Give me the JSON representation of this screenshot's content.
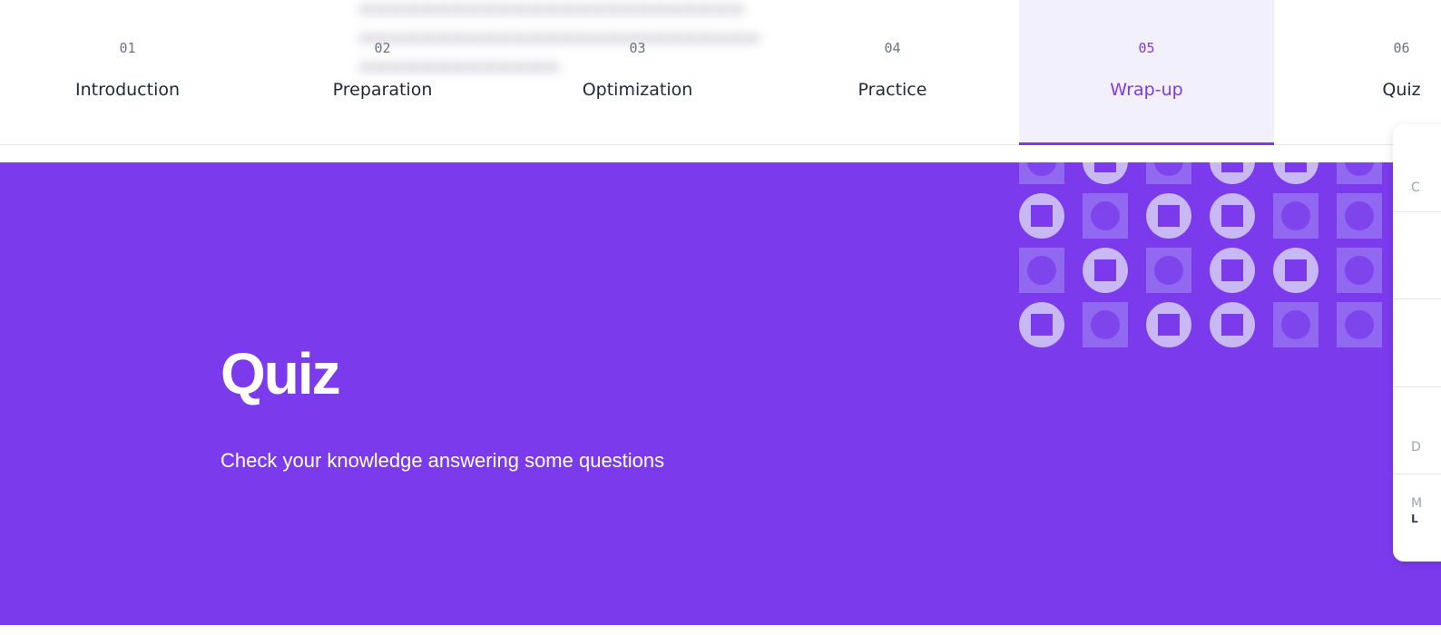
{
  "steps": [
    {
      "number": "01",
      "label": "Introduction",
      "active": false
    },
    {
      "number": "02",
      "label": "Preparation",
      "active": false
    },
    {
      "number": "03",
      "label": "Optimization",
      "active": false
    },
    {
      "number": "04",
      "label": "Practice",
      "active": false
    },
    {
      "number": "05",
      "label": "Wrap-up",
      "active": true
    },
    {
      "number": "06",
      "label": "Quiz",
      "active": false
    }
  ],
  "hero": {
    "title": "Quiz",
    "subtitle": "Check your knowledge answering some questions"
  },
  "side_panel": {
    "fragments": [
      "C",
      "D",
      "M",
      "L"
    ]
  },
  "colors": {
    "accent": "#7c3aed",
    "active_tab_bg": "#f3f0fd",
    "text": "#1f2937"
  },
  "pattern": {
    "rows": [
      [
        "square-dot",
        "circle-square",
        "square-dot",
        "circle-square",
        "circle-square",
        "square-dot"
      ],
      [
        "circle-square",
        "square-dot",
        "circle-square",
        "circle-square",
        "square-dot",
        "square-dot"
      ],
      [
        "square-dot",
        "circle-square",
        "square-dot",
        "circle-square",
        "circle-square",
        "square-dot"
      ],
      [
        "circle-square",
        "square-dot",
        "circle-square",
        "circle-square",
        "square-dot",
        "square-dot"
      ]
    ]
  }
}
